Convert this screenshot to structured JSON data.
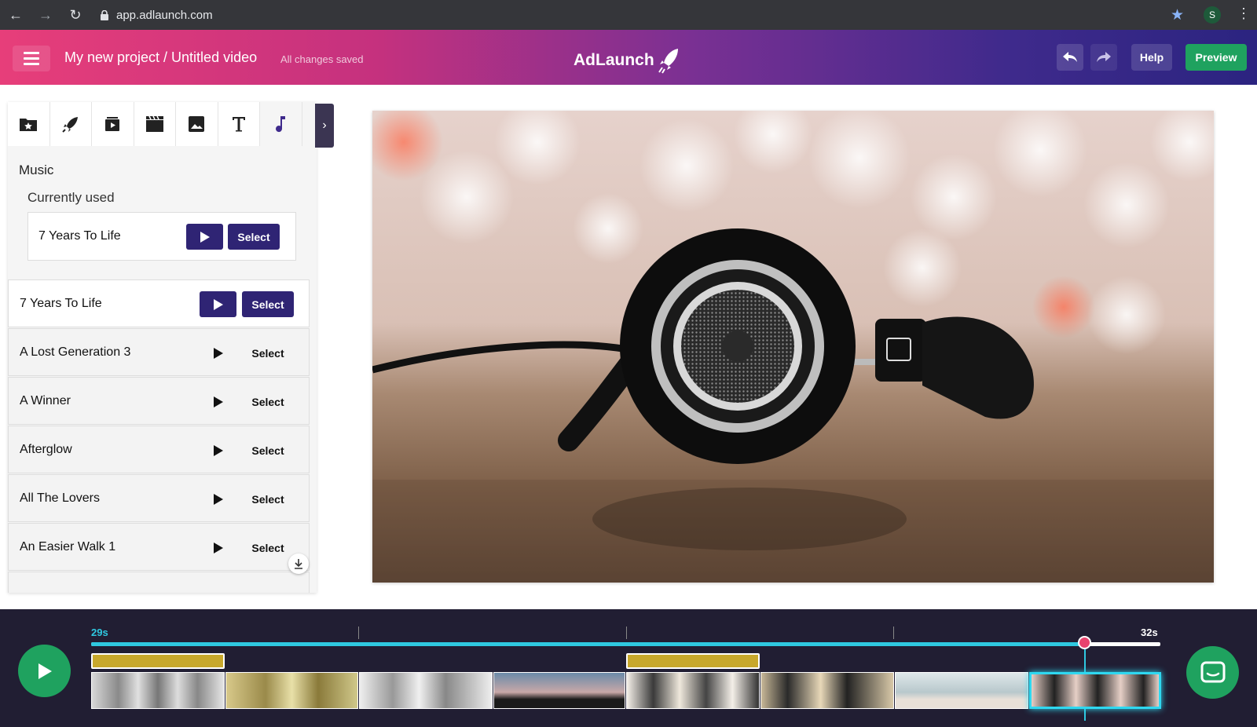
{
  "browser": {
    "url": "app.adlaunch.com",
    "avatar_letter": "S"
  },
  "header": {
    "project_title": "My new project / Untitled video",
    "save_status": "All changes saved",
    "brand": "AdLaunch",
    "help_label": "Help",
    "preview_label": "Preview"
  },
  "sidebar": {
    "tabs": [
      "favorites-icon",
      "rocket-icon",
      "video-library-icon",
      "film-icon",
      "image-icon",
      "text-icon",
      "music-note-icon"
    ],
    "active_tab": "music",
    "section_title": "Music",
    "current_title": "Currently used",
    "current_song": {
      "name": "7 Years To Life",
      "select_label": "Select"
    },
    "songs": [
      {
        "name": "7 Years To Life",
        "select_label": "Select",
        "highlighted": true
      },
      {
        "name": "A Lost Generation 3",
        "select_label": "Select",
        "highlighted": false
      },
      {
        "name": "A Winner",
        "select_label": "Select",
        "highlighted": false
      },
      {
        "name": "Afterglow",
        "select_label": "Select",
        "highlighted": false
      },
      {
        "name": "All The Lovers",
        "select_label": "Select",
        "highlighted": false
      },
      {
        "name": "An Easier Walk 1",
        "select_label": "Select",
        "highlighted": false
      }
    ]
  },
  "timeline": {
    "start_label": "29s",
    "end_label": "32s",
    "progress": 0.93,
    "clip_count": 8,
    "selected_clip": 8
  },
  "colors": {
    "accent": "#2f2474",
    "green": "#1fa25f",
    "cyan": "#2fc8e0",
    "playhead": "#e8436e",
    "gold": "#c8a82c"
  }
}
